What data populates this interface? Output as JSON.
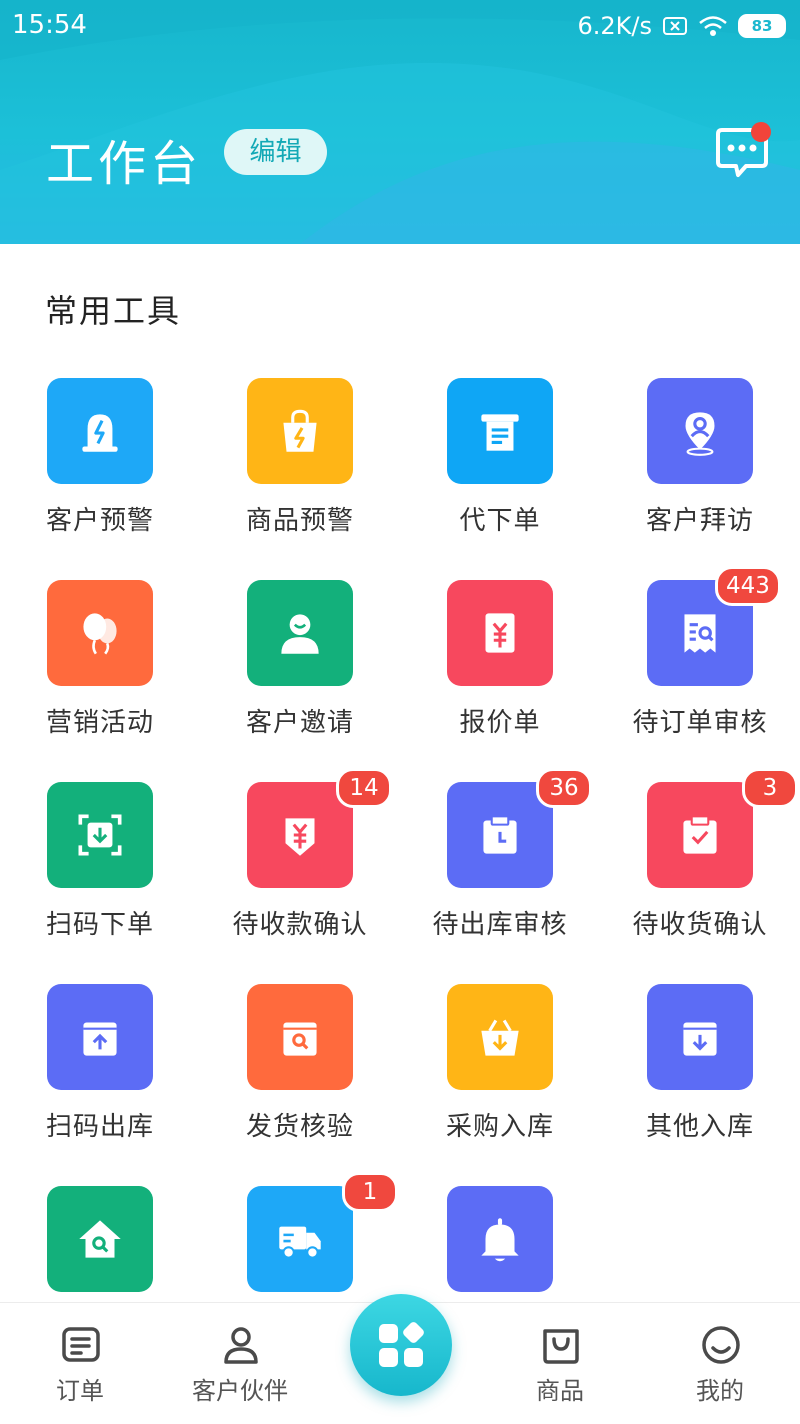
{
  "status_bar": {
    "time": "15:54",
    "network_speed": "6.2K/s",
    "battery": "83"
  },
  "header": {
    "title": "工作台",
    "edit_label": "编辑"
  },
  "section": {
    "title": "常用工具"
  },
  "colors": {
    "header": "#1cbcd3",
    "blue": "#1ea8f7",
    "yellow": "#ffb516",
    "indigo": "#5c6cf5",
    "orange": "#ff6a3d",
    "green": "#13b07b",
    "red": "#f7485e",
    "badge": "#f0483e"
  },
  "tools": [
    {
      "label": "客户预警",
      "icon": "alarm-light-icon",
      "color": "#1ea8f7",
      "badge": ""
    },
    {
      "label": "商品预警",
      "icon": "shopping-bag-bolt-icon",
      "color": "#ffb516",
      "badge": ""
    },
    {
      "label": "代下单",
      "icon": "receipt-printer-icon",
      "color": "#0fa6f5",
      "badge": ""
    },
    {
      "label": "客户拜访",
      "icon": "location-person-icon",
      "color": "#5c6cf5",
      "badge": ""
    },
    {
      "label": "营销活动",
      "icon": "balloons-icon",
      "color": "#ff6a3d",
      "badge": ""
    },
    {
      "label": "客户邀请",
      "icon": "user-icon",
      "color": "#13b07b",
      "badge": ""
    },
    {
      "label": "报价单",
      "icon": "yuan-document-icon",
      "color": "#f7485e",
      "badge": ""
    },
    {
      "label": "待订单审核",
      "icon": "document-search-icon",
      "color": "#5c6cf5",
      "badge": "443"
    },
    {
      "label": "扫码下单",
      "icon": "scan-download-icon",
      "color": "#13b07b",
      "badge": ""
    },
    {
      "label": "待收款确认",
      "icon": "yuan-arrow-icon",
      "color": "#f7485e",
      "badge": "14"
    },
    {
      "label": "待出库审核",
      "icon": "box-clock-icon",
      "color": "#5c6cf5",
      "badge": "36"
    },
    {
      "label": "待收货确认",
      "icon": "box-check-icon",
      "color": "#f7485e",
      "badge": "3"
    },
    {
      "label": "扫码出库",
      "icon": "box-upload-icon",
      "color": "#5c6cf5",
      "badge": ""
    },
    {
      "label": "发货核验",
      "icon": "box-search-icon",
      "color": "#ff6a3d",
      "badge": ""
    },
    {
      "label": "采购入库",
      "icon": "basket-download-icon",
      "color": "#ffb516",
      "badge": ""
    },
    {
      "label": "其他入库",
      "icon": "box-download-icon",
      "color": "#5c6cf5",
      "badge": ""
    },
    {
      "label": "",
      "icon": "house-search-icon",
      "color": "#13b07b",
      "badge": ""
    },
    {
      "label": "",
      "icon": "delivery-truck-icon",
      "color": "#1ea8f7",
      "badge": "1"
    },
    {
      "label": "",
      "icon": "bell-icon",
      "color": "#5c6cf5",
      "badge": ""
    }
  ],
  "nav": {
    "orders": "订单",
    "customers": "客户伙伴",
    "goods": "商品",
    "mine": "我的"
  }
}
